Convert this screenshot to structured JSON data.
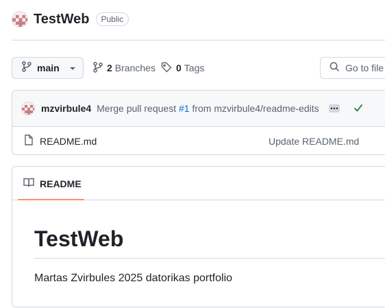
{
  "repo": {
    "name": "TestWeb",
    "visibility": "Public",
    "avatar_icon": "identicon-avatar"
  },
  "toolbar": {
    "branch": "main",
    "branches_count": "2",
    "branches_label": "Branches",
    "tags_count": "0",
    "tags_label": "Tags",
    "go_to_file_placeholder": "Go to file"
  },
  "latest_commit": {
    "author": "mzvirbule4",
    "message_prefix": "Merge pull request",
    "pr_number": "#1",
    "message_suffix": "from mzvirbule4/readme-edits",
    "status": "success"
  },
  "files": [
    {
      "name": "README.md",
      "last_commit": "Update README.md"
    }
  ],
  "readme": {
    "tab_label": "README",
    "title": "TestWeb",
    "body": "Martas Zvirbules 2025 datorikas portfolio"
  },
  "colors": {
    "link": "#0969da",
    "success": "#1a7f37",
    "tab_accent": "#fd8c73",
    "identicon": "#c97f84"
  }
}
